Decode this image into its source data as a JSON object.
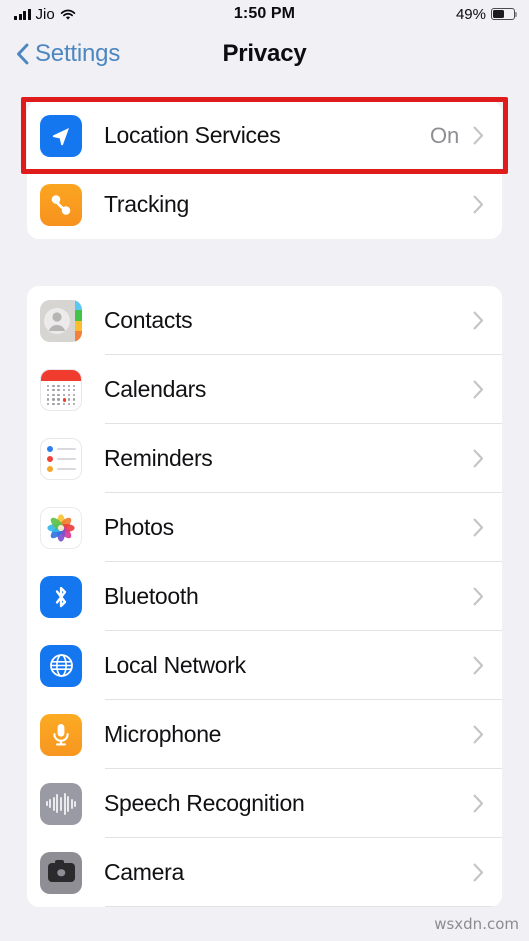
{
  "status_bar": {
    "carrier": "Jio",
    "signal_icon": "signal-bars-icon",
    "wifi_icon": "wifi-icon",
    "time": "1:50 PM",
    "battery_percent": "49%",
    "battery_icon": "battery-icon",
    "battery_level": 49
  },
  "nav": {
    "back_label": "Settings",
    "back_icon": "chevron-left-icon",
    "title": "Privacy"
  },
  "colors": {
    "background": "#f1f0f5",
    "card": "#ffffff",
    "accent_blue": "#4c87c0",
    "highlight_red": "#e01b1b",
    "value_gray": "#8e8e93",
    "separator": "#e2e2e5"
  },
  "groups": [
    {
      "rows": [
        {
          "label": "Location Services",
          "value": "On",
          "icon": "location-arrow-icon",
          "icon_class": "ic-location",
          "highlighted": true,
          "chevron_icon": "chevron-right-icon"
        },
        {
          "label": "Tracking",
          "value": "",
          "icon": "tracking-icon",
          "icon_class": "ic-tracking",
          "highlighted": false,
          "chevron_icon": "chevron-right-icon"
        }
      ]
    },
    {
      "rows": [
        {
          "label": "Contacts",
          "value": "",
          "icon": "contacts-icon",
          "icon_class": "ic-contacts",
          "highlighted": false,
          "chevron_icon": "chevron-right-icon"
        },
        {
          "label": "Calendars",
          "value": "",
          "icon": "calendar-icon",
          "icon_class": "ic-calendar",
          "highlighted": false,
          "chevron_icon": "chevron-right-icon"
        },
        {
          "label": "Reminders",
          "value": "",
          "icon": "reminders-icon",
          "icon_class": "ic-reminders",
          "highlighted": false,
          "chevron_icon": "chevron-right-icon"
        },
        {
          "label": "Photos",
          "value": "",
          "icon": "photos-icon",
          "icon_class": "ic-photos",
          "highlighted": false,
          "chevron_icon": "chevron-right-icon"
        },
        {
          "label": "Bluetooth",
          "value": "",
          "icon": "bluetooth-icon",
          "icon_class": "ic-bluetooth",
          "highlighted": false,
          "chevron_icon": "chevron-right-icon"
        },
        {
          "label": "Local Network",
          "value": "",
          "icon": "globe-icon",
          "icon_class": "ic-network",
          "highlighted": false,
          "chevron_icon": "chevron-right-icon"
        },
        {
          "label": "Microphone",
          "value": "",
          "icon": "microphone-icon",
          "icon_class": "ic-mic",
          "highlighted": false,
          "chevron_icon": "chevron-right-icon"
        },
        {
          "label": "Speech Recognition",
          "value": "",
          "icon": "waveform-icon",
          "icon_class": "ic-speech",
          "highlighted": false,
          "chevron_icon": "chevron-right-icon"
        },
        {
          "label": "Camera",
          "value": "",
          "icon": "camera-icon",
          "icon_class": "ic-camera",
          "highlighted": false,
          "chevron_icon": "chevron-right-icon"
        }
      ]
    }
  ],
  "watermark": "wsxdn.com"
}
